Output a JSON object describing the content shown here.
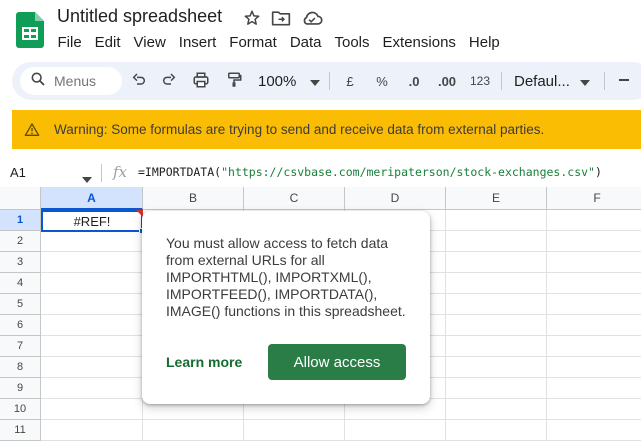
{
  "app": {
    "doc_title": "Untitled spreadsheet"
  },
  "menu": [
    "File",
    "Edit",
    "View",
    "Insert",
    "Format",
    "Data",
    "Tools",
    "Extensions",
    "Help"
  ],
  "toolbar": {
    "search_placeholder": "Menus",
    "zoom": "100%",
    "currency": "£",
    "percent": "%",
    "decrease_decimal": ".0",
    "increase_decimal": ".00",
    "number_format": "123",
    "font": "Defaul..."
  },
  "banner": {
    "text": "Warning: Some formulas are trying to send and receive data from external parties."
  },
  "formula_bar": {
    "name_box": "A1",
    "fx": "fx",
    "formula_prefix": "=IMPORTDATA(",
    "formula_string": "\"https://csvbase.com/meripaterson/stock-exchanges.csv\"",
    "formula_suffix": ")"
  },
  "grid": {
    "columns": [
      "A",
      "B",
      "C",
      "D",
      "E",
      "F"
    ],
    "rows": [
      "1",
      "2",
      "3",
      "4",
      "5",
      "6",
      "7",
      "8",
      "9",
      "10",
      "11"
    ],
    "active_cell_value": "#REF!"
  },
  "popup": {
    "lines": [
      "You must allow access to fetch data",
      "from external URLs for all",
      "IMPORTHTML(), IMPORTXML(),",
      "IMPORTFEED(), IMPORTDATA(),",
      "IMAGE() functions in this spreadsheet."
    ],
    "learn_more": "Learn more",
    "allow_access": "Allow access"
  },
  "colors": {
    "accent": "#0b57d0",
    "banner": "#fbbc04",
    "allow_button": "#2a7d46",
    "sheets_green": "#0f9d58"
  }
}
